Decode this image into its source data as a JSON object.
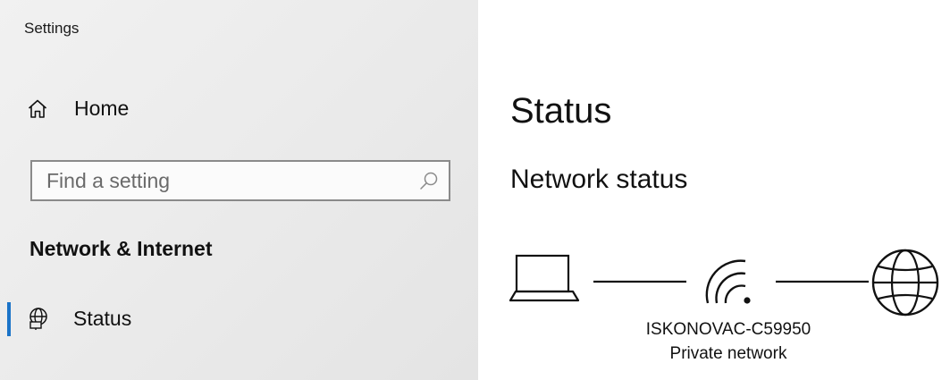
{
  "window": {
    "app_title": "Settings"
  },
  "sidebar": {
    "home": {
      "label": "Home",
      "icon": "home-icon"
    },
    "search": {
      "placeholder": "Find a setting",
      "value": "",
      "icon": "search-icon"
    },
    "section_heading": "Network & Internet",
    "items": [
      {
        "label": "Status",
        "icon": "network-status-icon",
        "selected": true
      }
    ]
  },
  "main": {
    "title": "Status",
    "subheading": "Network status",
    "diagram": {
      "nodes": [
        "laptop-icon",
        "wifi-icon",
        "globe-icon"
      ],
      "network_name": "ISKONOVAC-C59950",
      "network_type": "Private network"
    }
  },
  "colors": {
    "accent": "#1a73c8",
    "sidebar_bg": "#ececec",
    "text": "#111111",
    "placeholder": "#6a6a6a"
  }
}
